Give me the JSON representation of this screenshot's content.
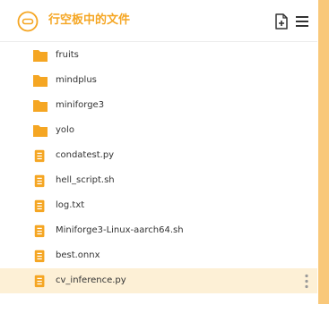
{
  "header": {
    "title": "行空板中的文件",
    "new_file_icon": "new-file-icon",
    "menu_icon": "hamburger-menu-icon"
  },
  "colors": {
    "accent": "#f5a623",
    "selected_row": "#fdf0d6",
    "scrollbar": "#f9c87a"
  },
  "files": [
    {
      "name": "fruits",
      "type": "folder",
      "icon": "folder-icon"
    },
    {
      "name": "mindplus",
      "type": "folder",
      "icon": "folder-icon"
    },
    {
      "name": "miniforge3",
      "type": "folder",
      "icon": "folder-icon"
    },
    {
      "name": "yolo",
      "type": "folder",
      "icon": "folder-icon"
    },
    {
      "name": "condatest.py",
      "type": "file",
      "icon": "file-icon"
    },
    {
      "name": "hell_script.sh",
      "type": "file",
      "icon": "file-icon"
    },
    {
      "name": "log.txt",
      "type": "file",
      "icon": "file-icon"
    },
    {
      "name": "Miniforge3-Linux-aarch64.sh",
      "type": "file",
      "icon": "file-icon"
    },
    {
      "name": "best.onnx",
      "type": "file",
      "icon": "file-icon"
    },
    {
      "name": "cv_inference.py",
      "type": "file",
      "icon": "file-icon",
      "selected": true
    }
  ]
}
